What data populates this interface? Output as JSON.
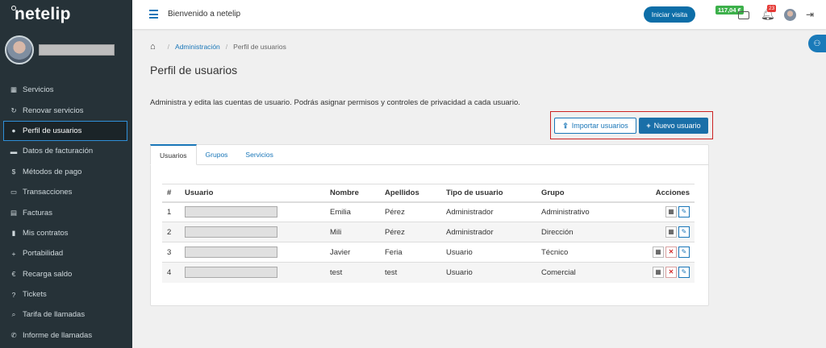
{
  "app": {
    "logo": "netelip",
    "welcome": "Bienvenido a netelip",
    "login_button": "Iniciar visita",
    "balance": "117,04 €",
    "notifications": "23"
  },
  "sidebar": {
    "items": [
      {
        "label": "Servicios",
        "icon": "grid-icon",
        "glyph": "▦"
      },
      {
        "label": "Renovar servicios",
        "icon": "refresh-icon",
        "glyph": "↻"
      },
      {
        "label": "Perfil de usuarios",
        "icon": "user-icon",
        "glyph": "●",
        "active": true
      },
      {
        "label": "Datos de facturación",
        "icon": "briefcase-icon",
        "glyph": "▬"
      },
      {
        "label": "Métodos de pago",
        "icon": "dollar-icon",
        "glyph": "$"
      },
      {
        "label": "Transacciones",
        "icon": "card-icon",
        "glyph": "▭"
      },
      {
        "label": "Facturas",
        "icon": "invoice-icon",
        "glyph": "▤"
      },
      {
        "label": "Mis contratos",
        "icon": "file-icon",
        "glyph": "▮"
      },
      {
        "label": "Portabilidad",
        "icon": "plus-icon",
        "glyph": "+"
      },
      {
        "label": "Recarga saldo",
        "icon": "euro-icon",
        "glyph": "€"
      },
      {
        "label": "Tickets",
        "icon": "help-icon",
        "glyph": "?"
      },
      {
        "label": "Tarifa de llamadas",
        "icon": "search-icon",
        "glyph": "⌕"
      },
      {
        "label": "Informe de llamadas",
        "icon": "phone-icon",
        "glyph": "✆"
      }
    ]
  },
  "breadcrumb": {
    "admin": "Administración",
    "current": "Perfil de usuarios"
  },
  "page": {
    "title": "Perfil de usuarios",
    "description": "Administra y edita las cuentas de usuario. Podrás asignar permisos y controles de privacidad a cada usuario.",
    "import_button": "Importar usuarios",
    "new_button": "Nuevo usuario"
  },
  "tabs": [
    "Usuarios",
    "Grupos",
    "Servicios"
  ],
  "table": {
    "headers": [
      "#",
      "Usuario",
      "Nombre",
      "Apellidos",
      "Tipo de usuario",
      "Grupo",
      "Acciones"
    ],
    "rows": [
      {
        "num": "1",
        "nombre": "Emilia",
        "apellidos": "Pérez",
        "tipo": "Administrador",
        "grupo": "Administrativo",
        "can_delete": false
      },
      {
        "num": "2",
        "nombre": "Mili",
        "apellidos": "Pérez",
        "tipo": "Administrador",
        "grupo": "Dirección",
        "can_delete": false
      },
      {
        "num": "3",
        "nombre": "Javier",
        "apellidos": "Feria",
        "tipo": "Usuario",
        "grupo": "Técnico",
        "can_delete": true
      },
      {
        "num": "4",
        "nombre": "test",
        "apellidos": "test",
        "tipo": "Usuario",
        "grupo": "Comercial",
        "can_delete": true
      }
    ]
  }
}
